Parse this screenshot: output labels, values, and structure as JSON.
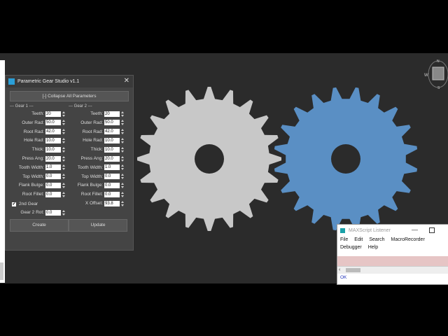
{
  "panel": {
    "title": "Parametric Gear Studio v1.1",
    "collapse_label": "[-] Collapse All Parameters",
    "gear1_header": "--- Gear 1 ---",
    "gear2_header": "--- Gear 2 ---",
    "gear1": [
      {
        "label": "Teeth:",
        "value": "20"
      },
      {
        "label": "Outer Rad:",
        "value": "50.0"
      },
      {
        "label": "Root Rad:",
        "value": "42.0"
      },
      {
        "label": "Hole Rad:",
        "value": "10.0"
      },
      {
        "label": "Thick:",
        "value": "10.0"
      },
      {
        "label": "Press Ang:",
        "value": "20.0"
      },
      {
        "label": "Tooth Width:",
        "value": "1.0"
      },
      {
        "label": "Top Width:",
        "value": "0.0"
      },
      {
        "label": "Flank Bulge:",
        "value": "0.0"
      },
      {
        "label": "Root Fillet:",
        "value": "0.0"
      }
    ],
    "gear2": [
      {
        "label": "Teeth:",
        "value": "20"
      },
      {
        "label": "Outer Rad:",
        "value": "50.0"
      },
      {
        "label": "Root Rad:",
        "value": "42.0"
      },
      {
        "label": "Hole Rad:",
        "value": "10.0"
      },
      {
        "label": "Thick:",
        "value": "10.0"
      },
      {
        "label": "Press Ang:",
        "value": "20.0"
      },
      {
        "label": "Tooth Width:",
        "value": "1.0"
      },
      {
        "label": "Top Width:",
        "value": "0.0"
      },
      {
        "label": "Flank Bulge:",
        "value": "0.0"
      },
      {
        "label": "Root Fillet:",
        "value": "0.0"
      },
      {
        "label": "X Offset:",
        "value": "93.8"
      }
    ],
    "second_gear_label": "2nd Gear",
    "second_gear_checked": true,
    "gear2_rot_label": "Gear 2 Rot:",
    "gear2_rot_value": "0.0",
    "create_label": "Create",
    "update_label": "Update"
  },
  "viewport": {
    "background": "#2b2b2b",
    "gear1_color": "#c8c8c8",
    "gear2_color": "#5a8fc4",
    "gear_teeth": 20,
    "viewcube_letters": [
      "N",
      "W",
      "S"
    ]
  },
  "listener": {
    "title": "MAXScript Listener",
    "menu": [
      "File",
      "Edit",
      "Search",
      "MacroRecorder",
      "Debugger",
      "Help"
    ],
    "output": "OK"
  }
}
